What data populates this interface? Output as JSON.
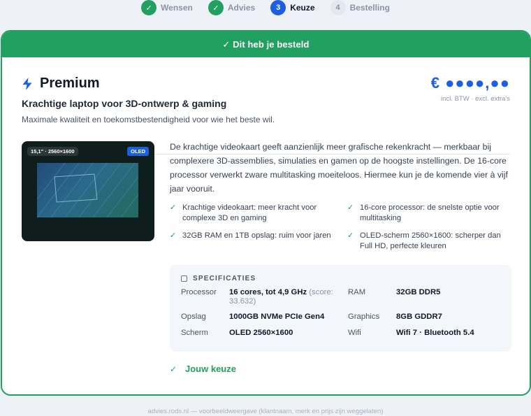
{
  "stepper": {
    "steps": [
      {
        "num": "✓",
        "label": "Wensen",
        "state": "done"
      },
      {
        "num": "✓",
        "label": "Advies",
        "state": "done"
      },
      {
        "num": "3",
        "label": "Keuze",
        "state": "active"
      },
      {
        "num": "4",
        "label": "Bestelling",
        "state": "todo"
      }
    ]
  },
  "banner": "✓ Dit heb je besteld",
  "product": {
    "icon": "bolt-icon",
    "title": "Premium",
    "subtitle": "Krachtige laptop voor 3D-ontwerp & gaming",
    "description": "Maximale kwaliteit en toekomstbestendigheid voor wie het beste wil.",
    "price": "€ ●●●●,●●",
    "price_note": "incl. BTW · excl. extra's",
    "image": {
      "badge_resolution": "15,1\" · 2560×1600",
      "badge_panel": "OLED"
    },
    "body": "De krachtige videokaart geeft aanzienlijk meer grafische rekenkracht — merkbaar bij complexere 3D-assemblies, simulaties en gamen op de hoogste instellingen. De 16-core processor verwerkt zware multitasking moeiteloos. Hiermee kun je de komende vier à vijf jaar vooruit.",
    "features": [
      "Krachtige videokaart: meer kracht voor complexe 3D en gaming",
      "16-core processor: de snelste optie voor multitasking",
      "32GB RAM en 1TB opslag: ruim voor jaren",
      "OLED-scherm 2560×1600: scherper dan Full HD, perfecte kleuren"
    ]
  },
  "specs": {
    "title": "SPECIFICATIES",
    "processor_label": "Processor",
    "processor_value": "16 cores, tot 4,9 GHz",
    "processor_score": "(score: 33.632)",
    "ram_label": "RAM",
    "ram_value": "32GB DDR5",
    "storage_label": "Opslag",
    "storage_value": "1000GB NVMe PCIe Gen4",
    "graphics_label": "Graphics",
    "graphics_value": "8GB GDDR7",
    "screen_label": "Scherm",
    "screen_value": "OLED 2560×1600",
    "wifi_label": "Wifi",
    "wifi_value": "Wifi 7 · Bluetooth 5.4"
  },
  "choice": "Jouw keuze",
  "footer": "advies.rods.nl — voorbeeldweergave (klantnaam, merk en prijs zijn weggelaten)",
  "colors": {
    "accent_green": "#22a060",
    "accent_blue": "#1d5fe0"
  }
}
